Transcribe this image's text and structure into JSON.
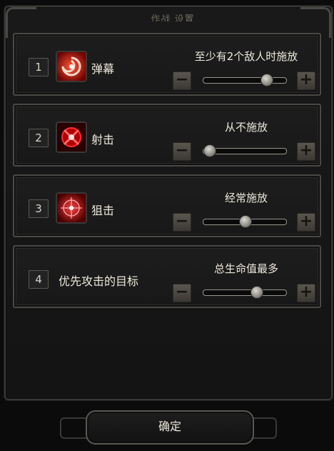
{
  "dialog": {
    "title": "作战 设置",
    "confirm_label": "确定"
  },
  "rows": [
    {
      "index": "1",
      "name": "弹幕",
      "icon": "swirl-skill-icon",
      "condition": "至少有2个敌人时施放",
      "slider_fraction": 0.8
    },
    {
      "index": "2",
      "name": "射击",
      "icon": "crosshair-skill-icon",
      "condition": "从不施放",
      "slider_fraction": 0.0
    },
    {
      "index": "3",
      "name": "狙击",
      "icon": "scope-skill-icon",
      "condition": "经常施放",
      "slider_fraction": 0.5
    },
    {
      "index": "4",
      "name": "优先攻击的目标",
      "icon": "",
      "condition": "总生命值最多",
      "slider_fraction": 0.66
    }
  ],
  "controls": {
    "minus_symbol": "−",
    "plus_symbol": "+"
  }
}
